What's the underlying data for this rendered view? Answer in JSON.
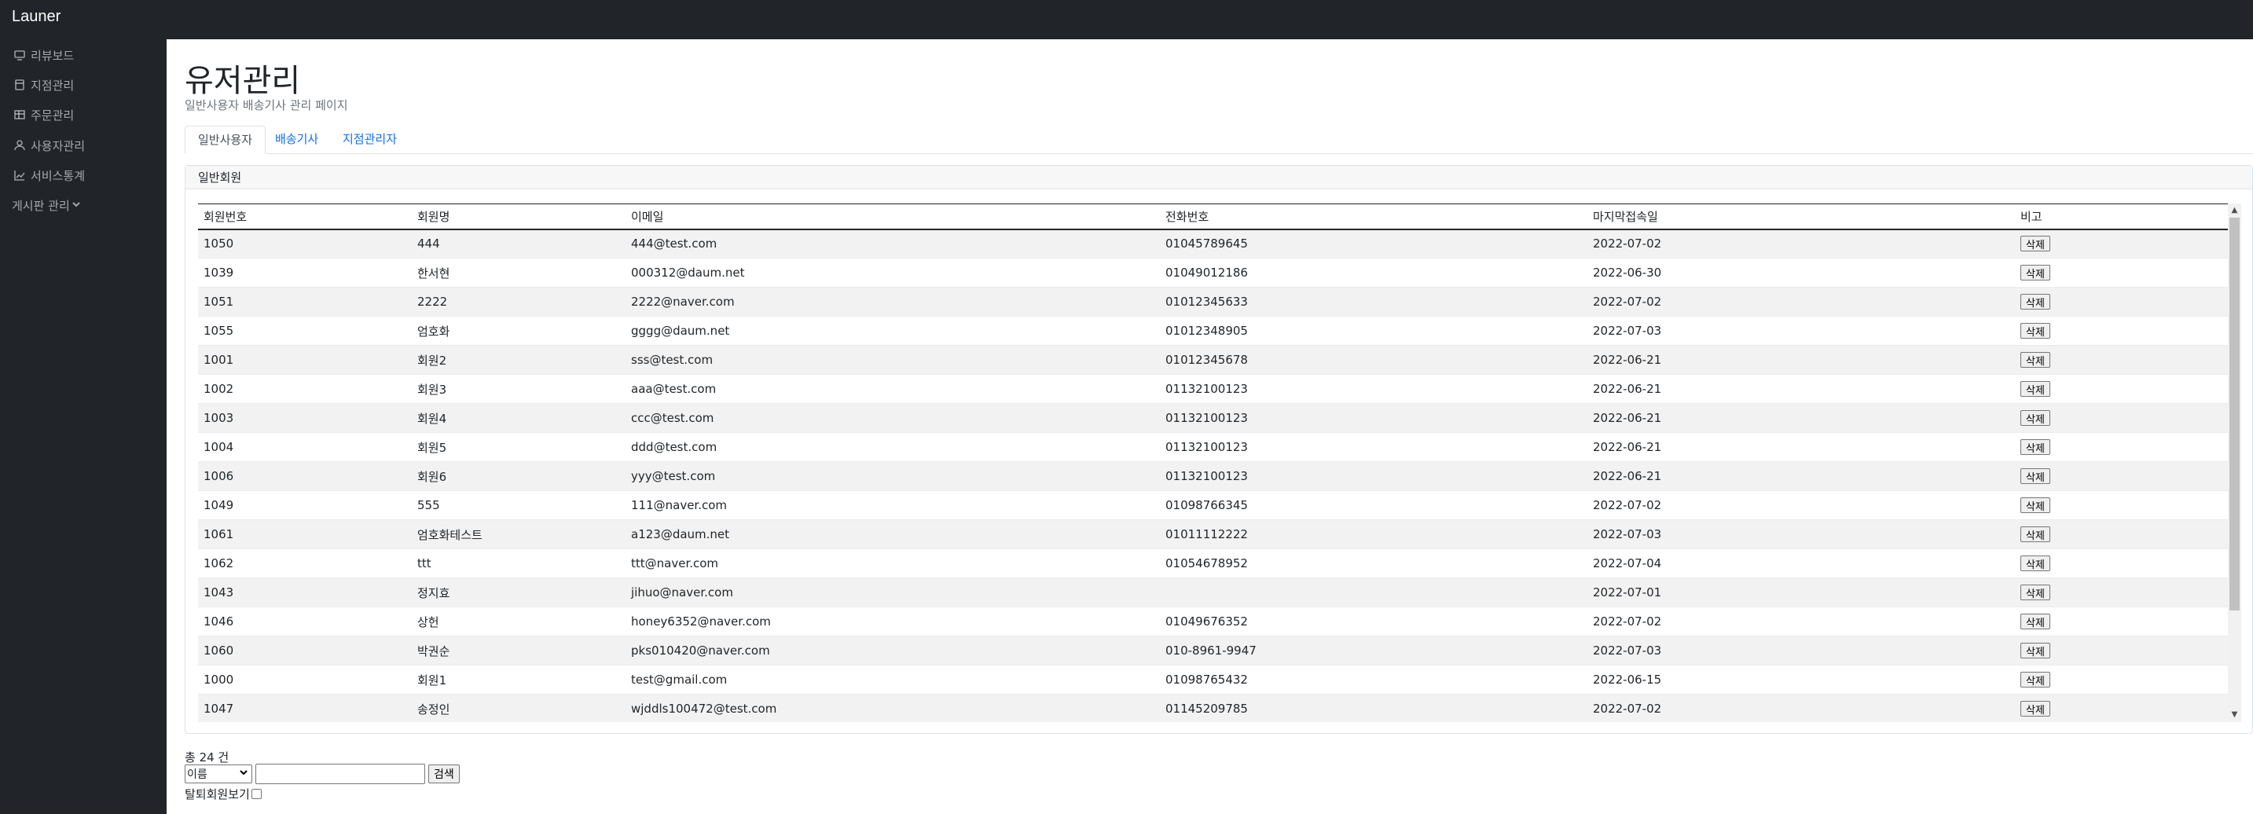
{
  "brand": "Launer",
  "sidebar": {
    "items": [
      {
        "label": "리뷰보드",
        "icon": "monitor-icon"
      },
      {
        "label": "지점관리",
        "icon": "store-icon"
      },
      {
        "label": "주문관리",
        "icon": "table-icon"
      },
      {
        "label": "사용자관리",
        "icon": "user-icon"
      },
      {
        "label": "서비스통계",
        "icon": "chart-icon"
      }
    ],
    "board_label": "게시판 관리"
  },
  "page": {
    "title": "유저관리",
    "subtitle": "일반사용자 배송기사 관리 페이지"
  },
  "tabs": [
    {
      "label": "일반사용자",
      "active": true
    },
    {
      "label": "배송기사",
      "active": false
    },
    {
      "label": "지점관리자",
      "active": false
    }
  ],
  "card": {
    "header": "일반회원"
  },
  "table": {
    "headers": [
      "회원번호",
      "회원명",
      "이메일",
      "전화번호",
      "마지막접속일",
      "비고"
    ],
    "delete_label": "삭제",
    "rows": [
      [
        "1050",
        "444",
        "444@test.com",
        "01045789645",
        "2022-07-02"
      ],
      [
        "1039",
        "한서현",
        "000312@daum.net",
        "01049012186",
        "2022-06-30"
      ],
      [
        "1051",
        "2222",
        "2222@naver.com",
        "01012345633",
        "2022-07-02"
      ],
      [
        "1055",
        "엄호화",
        "gggg@daum.net",
        "01012348905",
        "2022-07-03"
      ],
      [
        "1001",
        "회원2",
        "sss@test.com",
        "01012345678",
        "2022-06-21"
      ],
      [
        "1002",
        "회원3",
        "aaa@test.com",
        "01132100123",
        "2022-06-21"
      ],
      [
        "1003",
        "회원4",
        "ccc@test.com",
        "01132100123",
        "2022-06-21"
      ],
      [
        "1004",
        "회원5",
        "ddd@test.com",
        "01132100123",
        "2022-06-21"
      ],
      [
        "1006",
        "회원6",
        "yyy@test.com",
        "01132100123",
        "2022-06-21"
      ],
      [
        "1049",
        "555",
        "111@naver.com",
        "01098766345",
        "2022-07-02"
      ],
      [
        "1061",
        "엄호화테스트",
        "a123@daum.net",
        "01011112222",
        "2022-07-03"
      ],
      [
        "1062",
        "ttt",
        "ttt@naver.com",
        "01054678952",
        "2022-07-04"
      ],
      [
        "1043",
        "정지효",
        "jihuo@naver.com",
        "",
        "2022-07-01"
      ],
      [
        "1046",
        "상헌",
        "honey6352@naver.com",
        "01049676352",
        "2022-07-02"
      ],
      [
        "1060",
        "박권순",
        "pks010420@naver.com",
        "010-8961-9947",
        "2022-07-03"
      ],
      [
        "1000",
        "회원1",
        "test@gmail.com",
        "01098765432",
        "2022-06-15"
      ],
      [
        "1047",
        "송정인",
        "wjddls100472@test.com",
        "01145209785",
        "2022-07-02"
      ]
    ]
  },
  "footer": {
    "total": "총 24 건",
    "select_value": "이름",
    "search_value": "",
    "search_label": "검색",
    "withdrawn_label": "탈퇴회원보기"
  }
}
